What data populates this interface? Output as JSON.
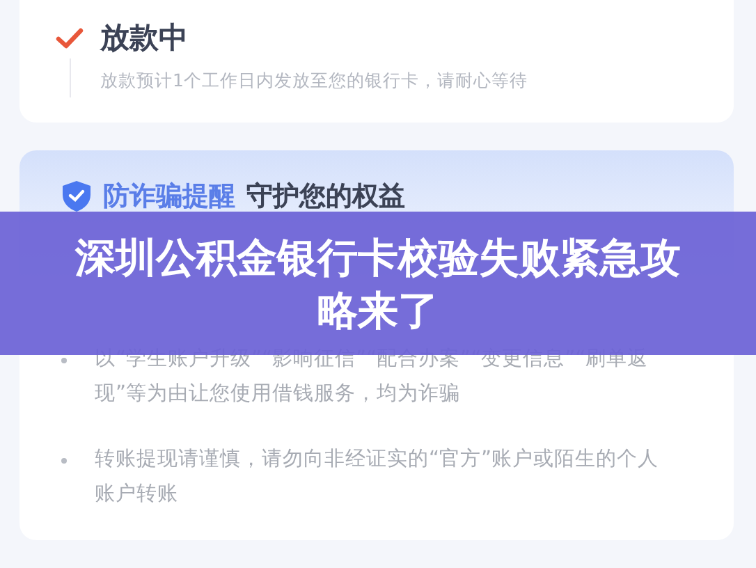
{
  "status_step": {
    "title": "放款中",
    "description": "放款预计1个工作日内发放至您的银行卡，请耐心等待",
    "done": true
  },
  "fraud_card": {
    "heading_highlight": "防诈骗提醒",
    "heading": "守护您的权益",
    "tips": [
      "以“学生账户升级”“影响征信”“配合办案”“变更信息”“刷单返现”等为由让您使用借钱服务，均为诈骗",
      "转账提现请谨慎，请勿向非经证实的“官方”账户或陌生的个人账户转账"
    ]
  },
  "banner": {
    "title": "深圳公积金银行卡校验失败紧急攻略来了"
  }
}
